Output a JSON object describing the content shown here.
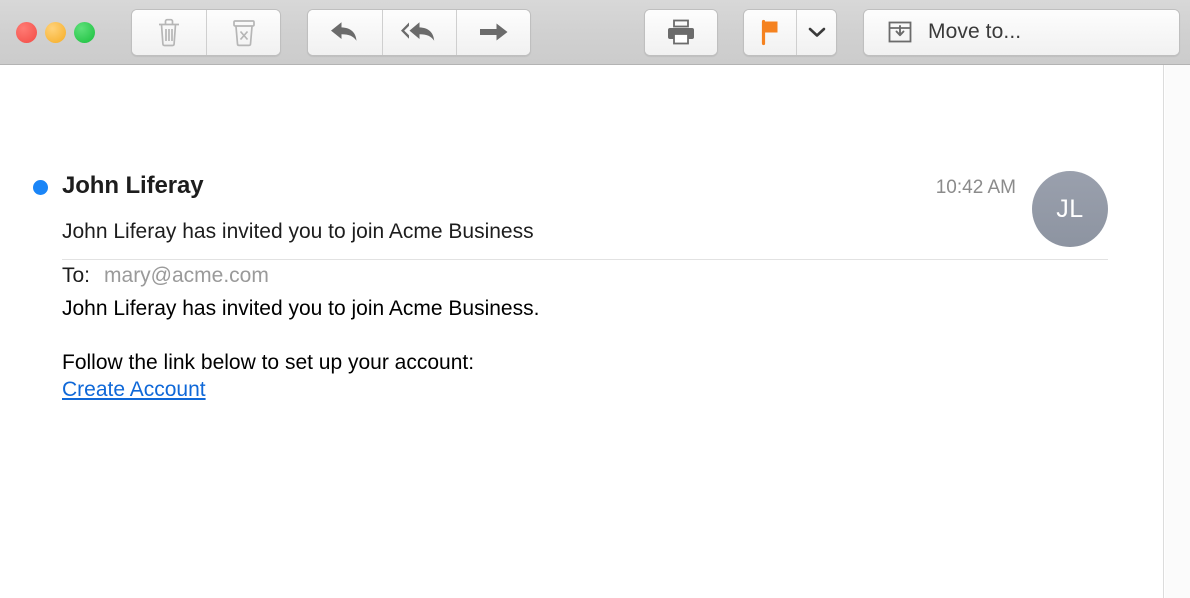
{
  "window": {
    "traffic_lights": [
      {
        "name": "close",
        "color": "#f24b45"
      },
      {
        "name": "minimize",
        "color": "#f5ac24"
      },
      {
        "name": "maximize",
        "color": "#19bf3c"
      }
    ]
  },
  "toolbar": {
    "delete_label": "Delete",
    "junk_label": "Junk",
    "reply_label": "Reply",
    "reply_all_label": "Reply All",
    "forward_label": "Forward",
    "print_label": "Print",
    "flag_label": "Flag",
    "flag_color": "#f5821f",
    "flag_menu_label": "Flag options",
    "move_to_label": "Move to...",
    "icons": {
      "delete": "trash-icon",
      "junk": "junk-bin-icon",
      "reply": "reply-arrow-icon",
      "reply_all": "reply-all-arrow-icon",
      "forward": "forward-arrow-icon",
      "print": "printer-icon",
      "flag": "flag-icon",
      "flag_caret": "chevron-down-icon",
      "move_to": "archive-box-down-icon"
    }
  },
  "message": {
    "unread": true,
    "unread_dot_color": "#1a85f7",
    "sender": "John Liferay",
    "timestamp": "10:42 AM",
    "avatar_initials": "JL",
    "avatar_color": "#9198a5",
    "subject": "John Liferay has invited you to join Acme Business",
    "to_label": "To:",
    "to_value": "mary@acme.com",
    "body": {
      "paragraph_1": "John Liferay has invited you to join Acme Business.",
      "paragraph_2": "Follow the link below to set up your account:",
      "link_text": "Create Account",
      "link_color": "#0f68d8"
    }
  }
}
